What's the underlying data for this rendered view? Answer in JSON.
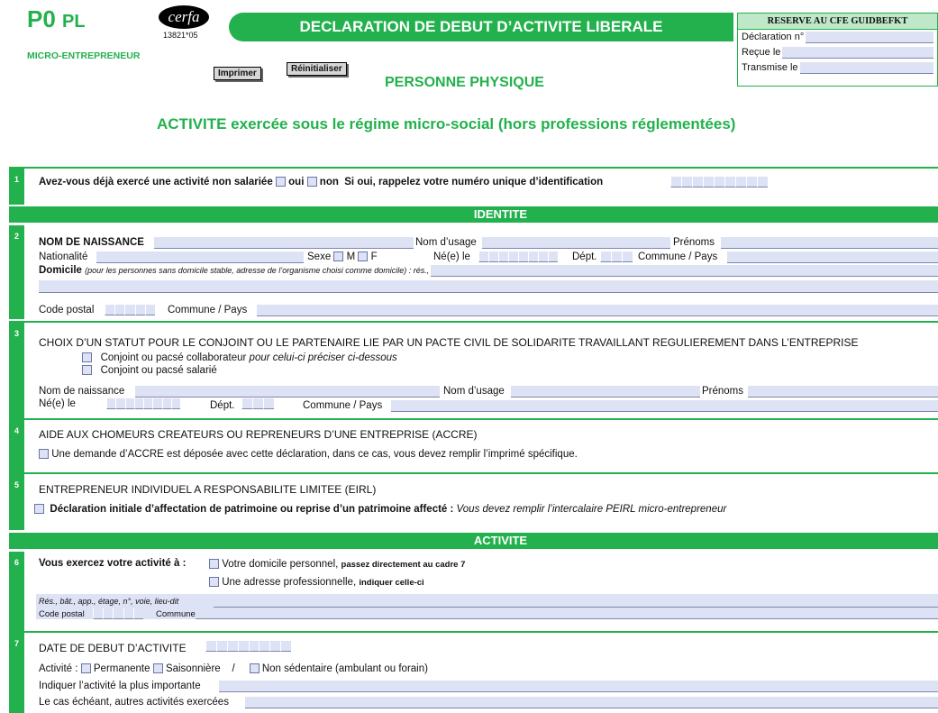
{
  "header": {
    "form_code": "P0",
    "form_code_suffix": "PL",
    "subtitle": "MICRO-ENTREPRENEUR",
    "cerfa_label": "cerfa",
    "cerfa_number": "13821*05",
    "banner_title": "DECLARATION DE DEBUT D’ACTIVITE LIBERALE",
    "person_type": "PERSONNE PHYSIQUE",
    "regime_title": "ACTIVITE exercée sous le régime micro-social (hors professions réglementées)",
    "print_button": "Imprimer",
    "reset_button": "Réinitialiser"
  },
  "reserved": {
    "title": "RESERVE AU CFE GUIDBEFKT",
    "declaration_label": "Déclaration n°",
    "received_label": "Reçue le",
    "transmitted_label": "Transmise le"
  },
  "s1": {
    "num": "1",
    "question": "Avez-vous déjà exercé une activité non salariée",
    "oui": "oui",
    "non": "non",
    "si_oui": "Si oui, rappelez votre numéro unique d’identification"
  },
  "identite_band": "IDENTITE",
  "s2": {
    "num": "2",
    "nom_naissance": "NOM DE NAISSANCE",
    "nom_usage": "Nom d’usage",
    "prenoms": "Prénoms",
    "nationalite": "Nationalité",
    "sexe": "Sexe",
    "m": "M",
    "f": "F",
    "ne_le": "Né(e) le",
    "dept": "Dépt.",
    "commune_pays": "Commune / Pays",
    "domicile": "Domicile",
    "domicile_note": "(pour les personnes sans domicile stable, adresse de l’organisme choisi comme domicile) : rés., bât., n°, voie, lieu-dit",
    "code_postal": "Code postal",
    "commune_pays2": "Commune / Pays"
  },
  "s3": {
    "num": "3",
    "title": "CHOIX D’UN STATUT POUR LE CONJOINT OU LE PARTENAIRE LIE PAR UN PACTE CIVIL DE SOLIDARITE TRAVAILLANT REGULIEREMENT DANS L’ENTREPRISE",
    "opt1": "Conjoint ou pacsé collaborateur",
    "opt1_note": "pour celui-ci préciser ci-dessous",
    "opt2": "Conjoint ou pacsé salarié",
    "nom_naissance": "Nom de naissance",
    "nom_usage": "Nom d’usage",
    "prenoms": "Prénoms",
    "ne_le": "Né(e) le",
    "dept": "Dépt.",
    "commune_pays": "Commune / Pays"
  },
  "s4": {
    "num": "4",
    "title": "AIDE AUX CHOMEURS CREATEURS OU REPRENEURS D’UNE ENTREPRISE (ACCRE)",
    "text": "Une demande d’ACCRE est déposée avec cette déclaration, dans ce cas, vous devez remplir l’imprimé spécifique."
  },
  "s5": {
    "num": "5",
    "title": "ENTREPRENEUR INDIVIDUEL A RESPONSABILITE LIMITEE (EIRL)",
    "text_bold": "Déclaration initiale d’affectation de patrimoine ou reprise d’un patrimoine affecté :",
    "text_italic": "Vous devez remplir l’intercalaire PEIRL micro-entrepreneur"
  },
  "activite_band": "ACTIVITE",
  "s6": {
    "num": "6",
    "question": "Vous exercez votre activité à :",
    "opt1": "Votre domicile personnel,",
    "opt1_note": "passez directement au cadre 7",
    "opt2": "Une adresse professionnelle,",
    "opt2_note": "indiquer celle-ci",
    "address_label": "Rés., bât., app., étage, n°, voie, lieu-dit",
    "code_postal": "Code postal",
    "commune": "Commune"
  },
  "s7": {
    "num": "7",
    "date_title": "DATE DE DEBUT D’ACTIVITE",
    "activite_label": "Activité :",
    "permanente": "Permanente",
    "saisonniere": "Saisonnière",
    "slash": "/",
    "non_sedentaire": "Non sédentaire",
    "non_sedentaire_note": "(ambulant ou forain)",
    "plus_importante": "Indiquer l’activité la plus importante",
    "autres": "Le cas échéant, autres activités exercées"
  },
  "colors": {
    "accent": "#22b14c",
    "field": "#dde2f5"
  }
}
